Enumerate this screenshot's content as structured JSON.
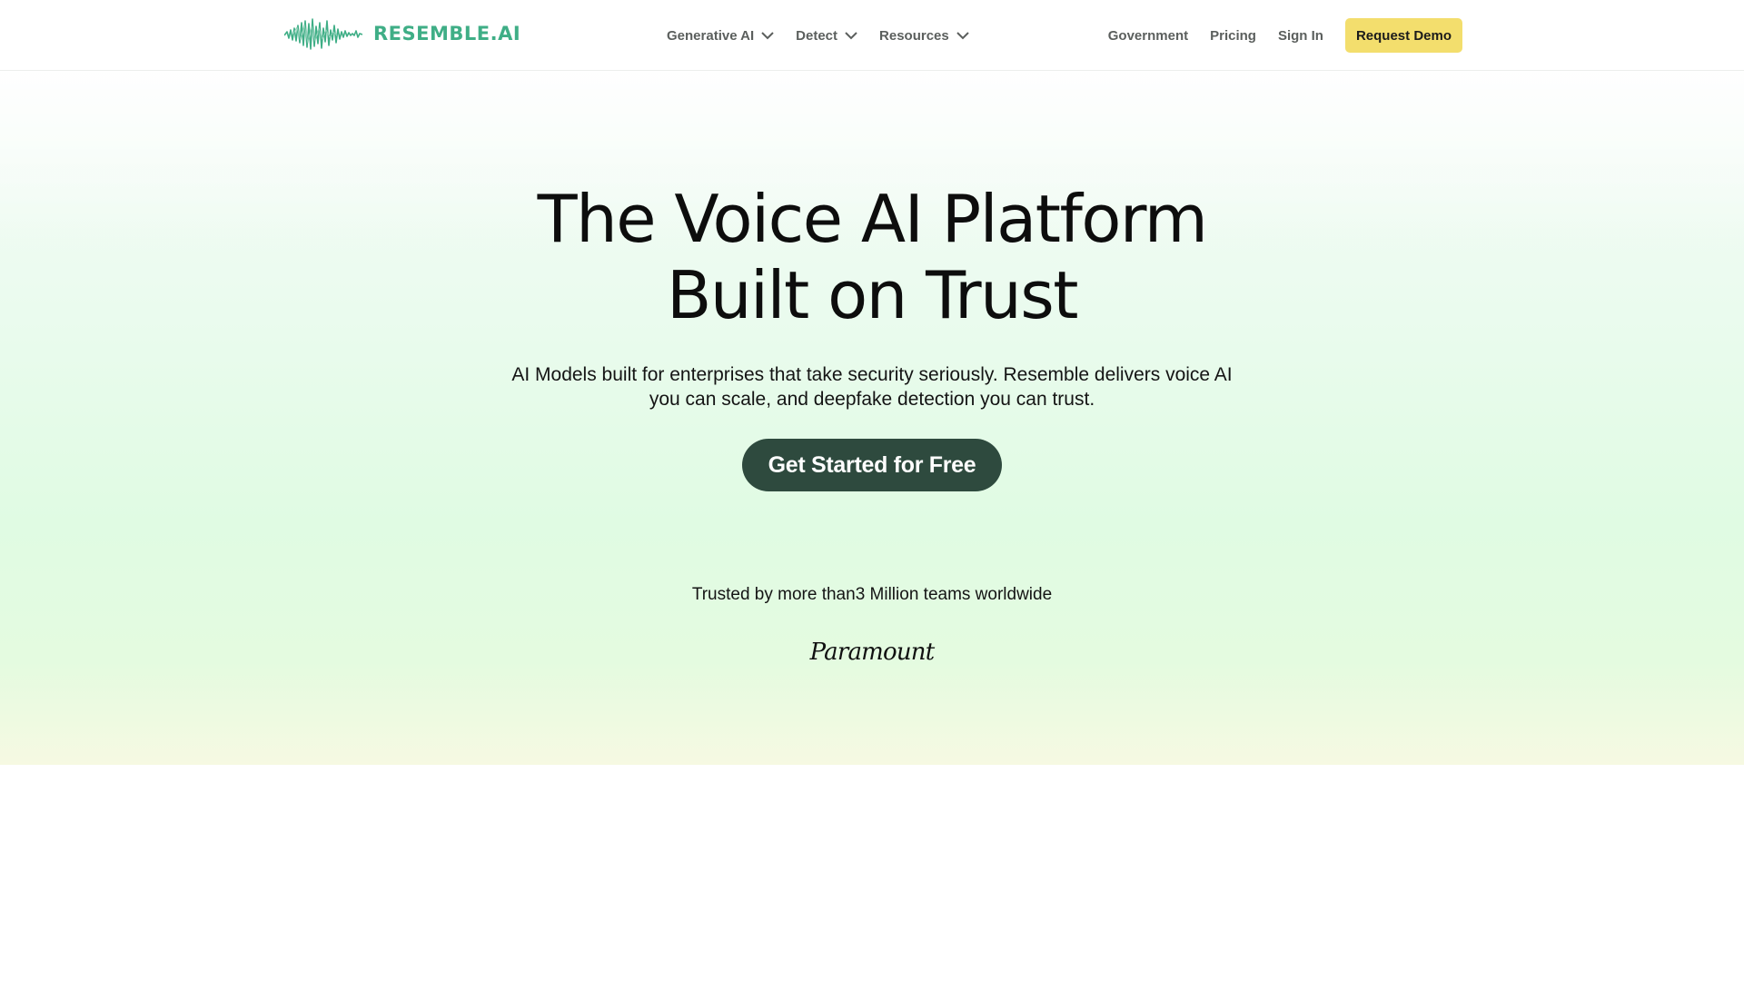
{
  "brand": {
    "name": "RESEMBLE.AI",
    "icon": "waveform-logo-icon",
    "color": "#3fae86"
  },
  "nav": {
    "menu": [
      {
        "label": "Generative AI",
        "icon": "chevron-down-icon"
      },
      {
        "label": "Detect",
        "icon": "chevron-down-icon"
      },
      {
        "label": "Resources",
        "icon": "chevron-down-icon"
      }
    ],
    "links": [
      "Government",
      "Pricing",
      "Sign In"
    ],
    "cta_label": "Request Demo",
    "cta_color": "#f3de6d"
  },
  "hero": {
    "title_line1": "The Voice AI Platform",
    "title_line2": "Built on Trust",
    "subtitle": "AI Models built for enterprises that take security seriously. Resemble delivers voice AI you can scale, and deepfake detection you can trust.",
    "cta_label": "Get Started for Free",
    "cta_color": "#2e4a3e",
    "trusted_text": "Trusted by more than3 Million teams worldwide",
    "partner_logo": "Paramount"
  }
}
